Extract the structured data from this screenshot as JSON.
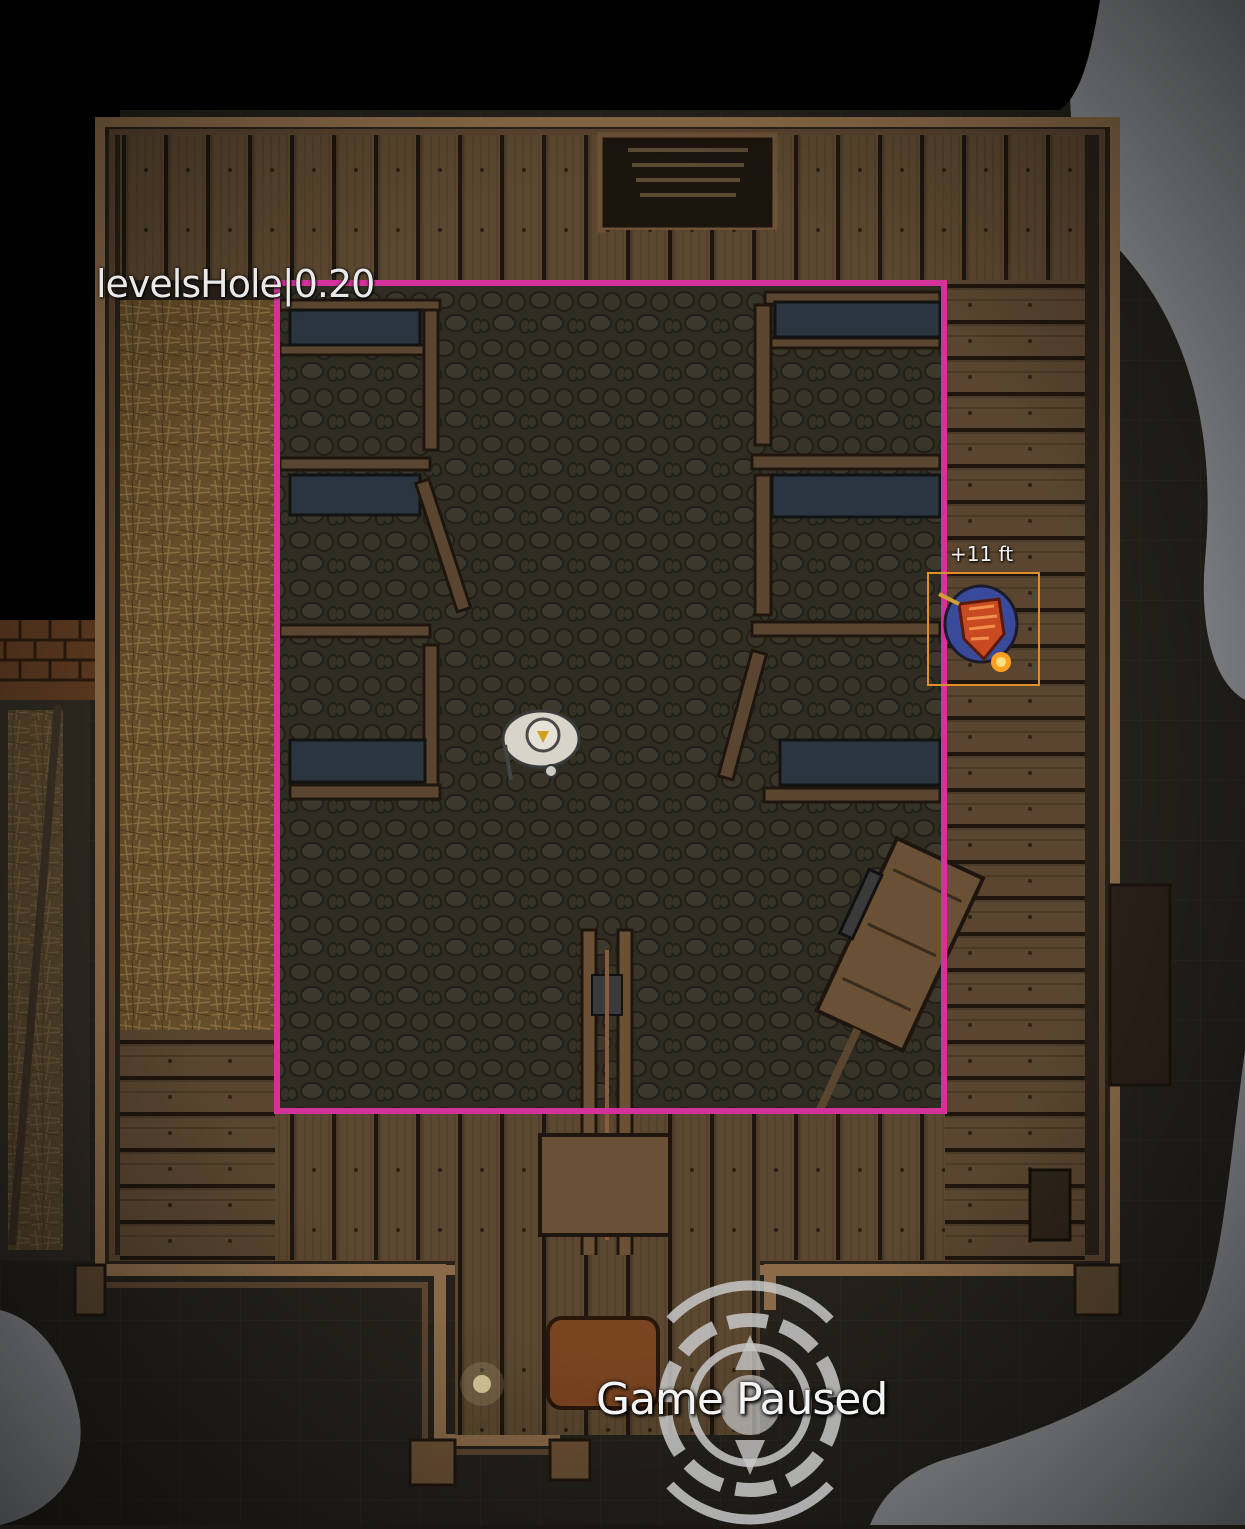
{
  "canvas": {
    "region_label": "levelsHole|0.20",
    "region_color": "#d2329a"
  },
  "tokens": [
    {
      "kind": "enemy",
      "elevation": "+11 ft",
      "border_color": "#e08d2a"
    },
    {
      "kind": "player"
    }
  ],
  "status": {
    "paused_label": "Game Paused"
  }
}
